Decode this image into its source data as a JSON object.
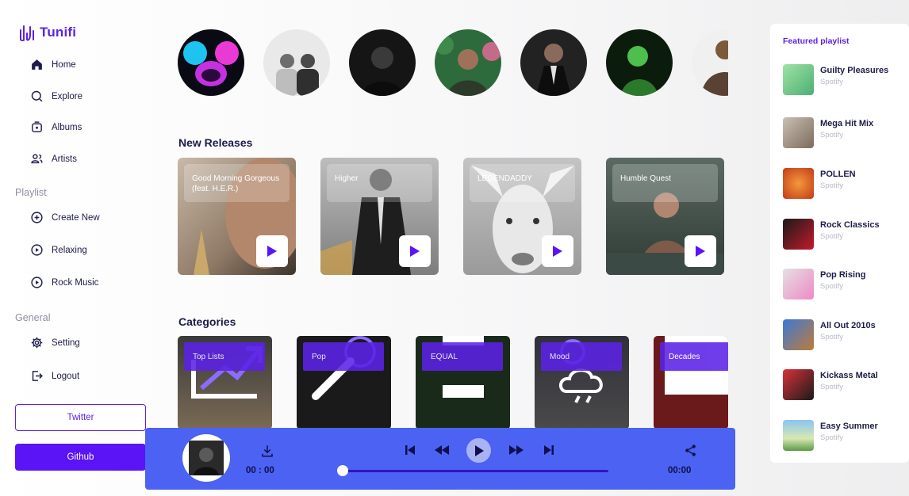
{
  "app": {
    "name": "Tunifi"
  },
  "sidebar": {
    "nav": [
      {
        "label": "Home",
        "icon": "home-icon"
      },
      {
        "label": "Explore",
        "icon": "search-icon"
      },
      {
        "label": "Albums",
        "icon": "album-icon"
      },
      {
        "label": "Artists",
        "icon": "users-icon"
      }
    ],
    "playlist_title": "Playlist",
    "playlists": [
      {
        "label": "Create New",
        "icon": "plus-circle-icon"
      },
      {
        "label": "Relaxing",
        "icon": "play-circle-icon"
      },
      {
        "label": "Rock Music",
        "icon": "play-circle-icon"
      }
    ],
    "general_title": "General",
    "general": [
      {
        "label": "Setting",
        "icon": "gear-icon"
      },
      {
        "label": "Logout",
        "icon": "logout-icon"
      }
    ],
    "twitter_label": "Twitter",
    "github_label": "Github"
  },
  "artists_count": 7,
  "new_releases": {
    "title": "New Releases",
    "items": [
      {
        "title": "Good Morning Gorgeous (feat. H.E.R.)"
      },
      {
        "title": "Higher"
      },
      {
        "title": "LEGENDADDY"
      },
      {
        "title": "Humble Quest"
      }
    ]
  },
  "categories": {
    "title": "Categories",
    "items": [
      {
        "label": "Top Lists"
      },
      {
        "label": "Pop"
      },
      {
        "label": "EQUAL"
      },
      {
        "label": "Mood"
      },
      {
        "label": "Decades"
      }
    ]
  },
  "player": {
    "current_time": "00 : 00",
    "duration": "00:00",
    "progress": 0
  },
  "featured": {
    "title": "Featured playlist",
    "items": [
      {
        "name": "Guilty Pleasures",
        "source": "Spotify"
      },
      {
        "name": "Mega Hit Mix",
        "source": "Spotify"
      },
      {
        "name": "POLLEN",
        "source": "Spotify"
      },
      {
        "name": "Rock Classics",
        "source": "Spotify"
      },
      {
        "name": "Pop Rising",
        "source": "Spotify"
      },
      {
        "name": "All Out 2010s",
        "source": "Spotify"
      },
      {
        "name": "Kickass Metal",
        "source": "Spotify"
      },
      {
        "name": "Easy Summer",
        "source": "Spotify"
      }
    ]
  },
  "colors": {
    "accent": "#5b22e6",
    "player": "#4b62f3",
    "github": "#5a14f5",
    "text": "#1c1b4a"
  }
}
